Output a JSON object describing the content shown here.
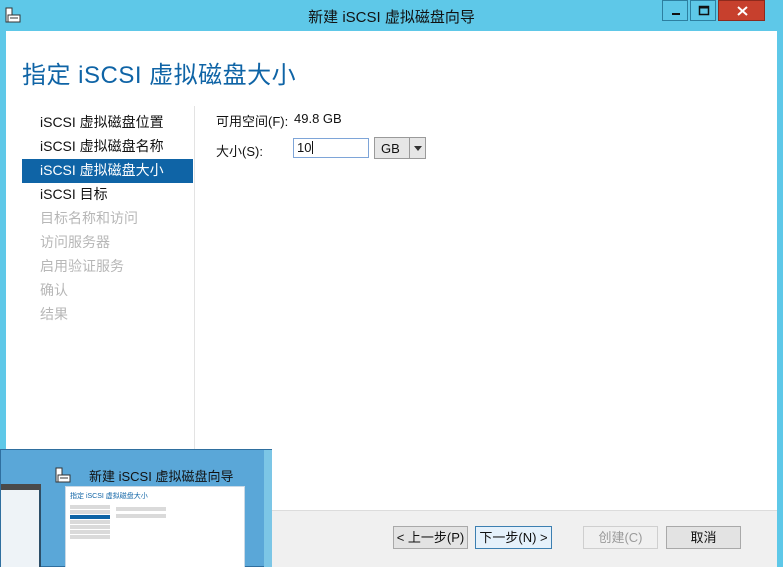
{
  "window": {
    "title": "新建 iSCSI 虚拟磁盘向导"
  },
  "page": {
    "title": "指定 iSCSI 虚拟磁盘大小"
  },
  "nav": {
    "items": [
      {
        "label": "iSCSI 虚拟磁盘位置",
        "state": "normal"
      },
      {
        "label": "iSCSI 虚拟磁盘名称",
        "state": "normal"
      },
      {
        "label": "iSCSI 虚拟磁盘大小",
        "state": "active"
      },
      {
        "label": "iSCSI 目标",
        "state": "normal"
      },
      {
        "label": "目标名称和访问",
        "state": "disabled"
      },
      {
        "label": "访问服务器",
        "state": "disabled"
      },
      {
        "label": "启用验证服务",
        "state": "disabled"
      },
      {
        "label": "确认",
        "state": "disabled"
      },
      {
        "label": "结果",
        "state": "disabled"
      }
    ]
  },
  "form": {
    "available_label": "可用空间(F):",
    "available_value": "49.8 GB",
    "size_label": "大小(S):",
    "size_value": "10",
    "unit_selected": "GB"
  },
  "buttons": {
    "prev": "< 上一步(P)",
    "next": "下一步(N) >",
    "create": "创建(C)",
    "cancel": "取消"
  },
  "taskbar_preview": {
    "title": "新建 iSCSI 虚拟磁盘向导"
  },
  "colors": {
    "accent": "#0f64a6",
    "titlebar": "#5ec8e8",
    "close_button": "#c7402d"
  }
}
